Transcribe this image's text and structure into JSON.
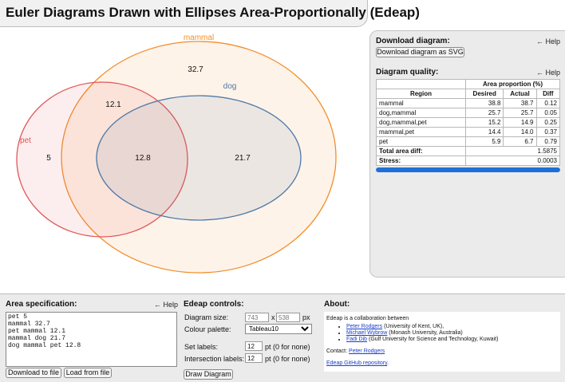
{
  "header": {
    "title": "Euler Diagrams Drawn with Ellipses Area-Proportionally (Edeap)"
  },
  "diagram": {
    "set_labels": {
      "mammal": "mammal",
      "dog": "dog",
      "pet": "pet"
    },
    "region_values": {
      "mammal": "32.7",
      "pet_mammal": "12.1",
      "pet": "5",
      "dog_mammal_pet": "12.8",
      "dog_mammal": "21.7"
    },
    "colors": {
      "mammal": "#f28e2b",
      "dog": "#4e79a7",
      "pet": "#e15759"
    }
  },
  "download": {
    "title": "Download diagram:",
    "help": "← Help",
    "button": "Download diagram as SVG"
  },
  "quality": {
    "title": "Diagram quality:",
    "help": "← Help",
    "group_header": "Area proportion (%)",
    "columns": {
      "region": "Region",
      "desired": "Desired",
      "actual": "Actual",
      "diff": "Diff"
    },
    "rows": [
      {
        "region": "mammal",
        "desired": "38.8",
        "actual": "38.7",
        "diff": "0.12"
      },
      {
        "region": "dog,mammal",
        "desired": "25.7",
        "actual": "25.7",
        "diff": "0.05"
      },
      {
        "region": "dog,mammal,pet",
        "desired": "15.2",
        "actual": "14.9",
        "diff": "0.25"
      },
      {
        "region": "mammal,pet",
        "desired": "14.4",
        "actual": "14.0",
        "diff": "0.37"
      },
      {
        "region": "pet",
        "desired": "5.9",
        "actual": "6.7",
        "diff": "0.79"
      }
    ],
    "total_label": "Total area diff:",
    "total_value": "1.5875",
    "stress_label": "Stress:",
    "stress_value": "0.0003",
    "progress": 1.0
  },
  "area_spec": {
    "title": "Area specification:",
    "help": "← Help",
    "text": "pet 5\nmammal 32.7\npet mammal 12.1\nmammal dog 21.7\ndog mammal pet 12.8",
    "download_button": "Download to file",
    "load_button": "Load from file"
  },
  "controls": {
    "title": "Edeap controls:",
    "diagram_size_label": "Diagram size:",
    "width_placeholder": "743",
    "x_label": "x",
    "height_placeholder": "538",
    "px_label": "px",
    "palette_label": "Colour palette:",
    "palette_value": "Tableau10",
    "set_labels_label": "Set labels:",
    "set_labels_value": "12",
    "set_labels_hint": "pt   (0 for none)",
    "intersection_label": "Intersection labels:",
    "intersection_value": "12",
    "intersection_hint": "pt   (0 for none)",
    "draw_button": "Draw Diagram"
  },
  "about": {
    "title": "About:",
    "intro": "Edeap is a collaboration between",
    "people": [
      {
        "name": "Peter Rodgers",
        "affiliation": "(University of Kent, UK),"
      },
      {
        "name": "Michael Wybrow",
        "affiliation": "(Monash University, Australia)"
      },
      {
        "name": "Fadi Dib",
        "affiliation": "(Gulf University for Science and Technology, Kuwait)"
      }
    ],
    "contact_label": "Contact:",
    "contact_name": "Peter Rodgers",
    "repo_link": "Edeap GitHub repository",
    "repo_suffix": "."
  }
}
